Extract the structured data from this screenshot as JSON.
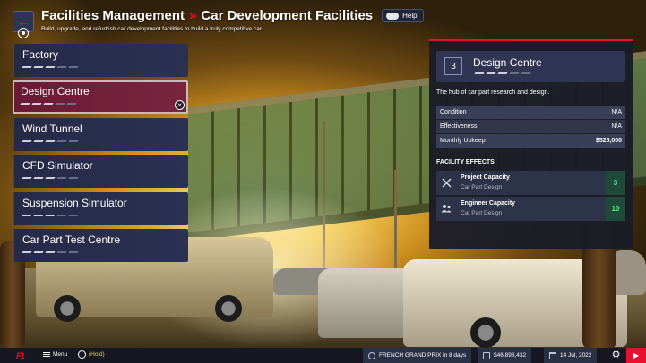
{
  "header": {
    "title": "Facilities Management",
    "separator": "»",
    "subtitle_title": "Car Development Facilities",
    "help_label": "Help",
    "description": "Build, upgrade, and refurbish car development facilities to build a truly competitive car."
  },
  "facilities": [
    {
      "name": "Factory",
      "selected": false
    },
    {
      "name": "Design Centre",
      "selected": true
    },
    {
      "name": "Wind Tunnel",
      "selected": false
    },
    {
      "name": "CFD Simulator",
      "selected": false
    },
    {
      "name": "Suspension Simulator",
      "selected": false
    },
    {
      "name": "Car Part Test Centre",
      "selected": false
    }
  ],
  "panel": {
    "level": "3",
    "title": "Design Centre",
    "description": "The hub of car part research and design.",
    "stats": [
      {
        "label": "Condition",
        "value": "N/A"
      },
      {
        "label": "Effectiveness",
        "value": "N/A"
      },
      {
        "label": "Monthly Upkeep",
        "value": "$525,000"
      }
    ],
    "effects_title": "FACILITY EFFECTS",
    "effects": [
      {
        "name": "Project Capacity",
        "category": "Car Part Design",
        "value": "3",
        "icon": "tools-icon"
      },
      {
        "name": "Engineer Capacity",
        "category": "Car Part Design",
        "value": "10",
        "icon": "people-icon"
      }
    ]
  },
  "footer": {
    "logo": "F1",
    "menu_label": "Menu",
    "hold_label": "(Hold)",
    "next_race": "FRENCH GRAND PRIX in 8 days",
    "balance": "$46,898,432",
    "date": "14 Jul, 2022"
  },
  "colors": {
    "accent": "#e8102e",
    "selected_item": "#7a2440",
    "effect_value": "#4ff08a",
    "panel_bg": "#1a1c26"
  }
}
